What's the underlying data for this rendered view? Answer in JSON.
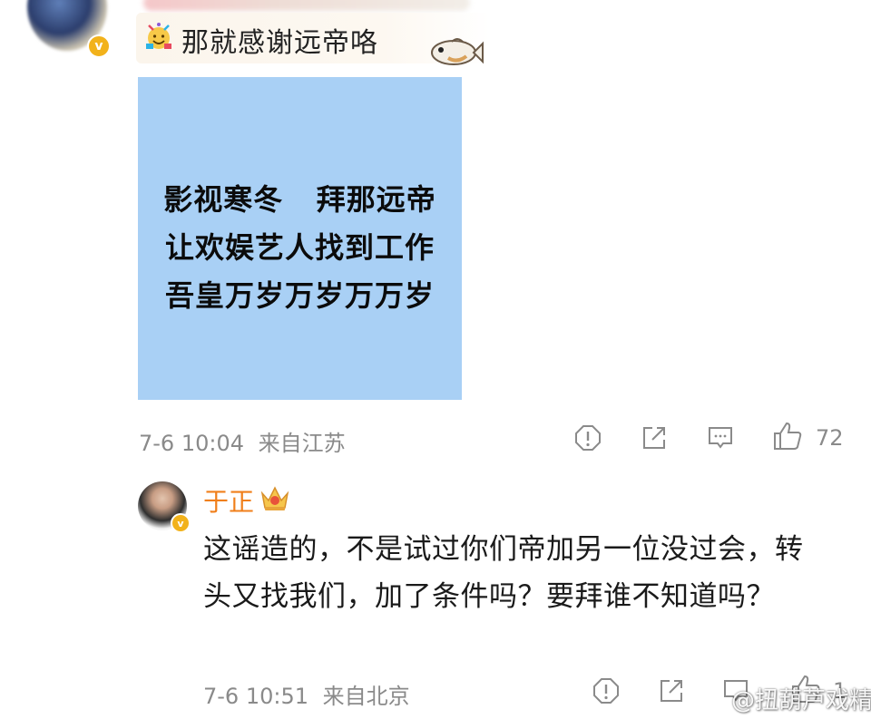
{
  "top_comment": {
    "text": "那就感谢远帝咯",
    "emoji_icon": "party-emoji-icon",
    "sticker_icon": "fish-sticker-icon",
    "image_lines": [
      "影视寒冬   拜那远帝",
      "让欢娱艺人找到工作",
      "吾皇万岁万岁万万岁"
    ],
    "image_bg": "#a9d0f5",
    "time": "7-6 10:04",
    "location": "来自江苏",
    "likes": "72"
  },
  "reply": {
    "author": "于正",
    "author_color": "#f07f1b",
    "text": "这谣造的，不是试过你们帝加另一位没过会，转头又找我们，加了条件吗？要拜谁不知道吗？",
    "time": "7-6 10:51",
    "location": "来自北京",
    "likes": "1"
  },
  "watermark": "@扭葫芦戏精"
}
